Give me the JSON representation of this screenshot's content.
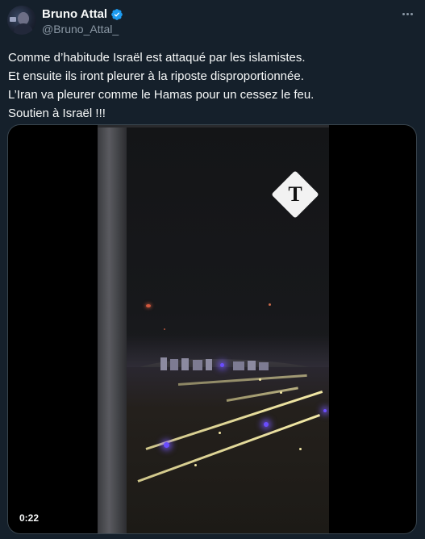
{
  "author": {
    "display_name": "Bruno Attal",
    "handle": "@Bruno_Attal_",
    "verified": true,
    "avatar_icon": "avatar-photo"
  },
  "tweet": {
    "lines": [
      "Comme d’habitude Israël est attaqué par les islamistes.",
      "Et ensuite ils iront pleurer à la riposte disproportionnée.",
      "L’Iran va pleurer comme le Hamas pour un cessez le feu.",
      "Soutien à Israël !!!"
    ]
  },
  "media": {
    "type": "video",
    "duration": "0:22",
    "watermark_icon": "telegraph-logo-icon"
  },
  "colors": {
    "background": "#15202b",
    "text": "#f7f9f9",
    "secondary_text": "#8b98a5",
    "verified_blue": "#1d9bf0",
    "border": "#38444d"
  }
}
